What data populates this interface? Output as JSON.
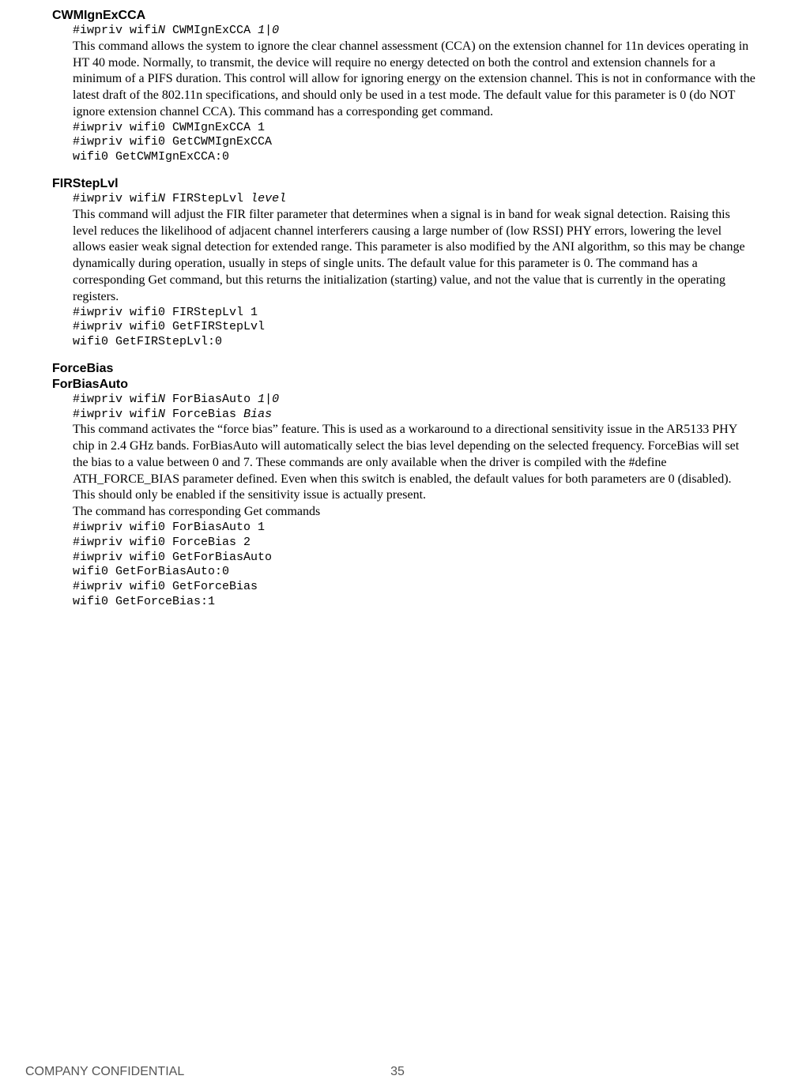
{
  "sections": [
    {
      "title": "CWMIgnExCCA",
      "syntax_prefix": "#iwpriv wifi",
      "syntax_var1": "N",
      "syntax_mid": " CWMIgnExCCA ",
      "syntax_var2": "1|0",
      "desc": "This command allows the system to ignore the clear channel assessment (CCA) on the extension channel for 11n devices operating in HT 40 mode. Normally, to transmit, the device will require no energy detected on both the control and extension channels for a minimum of a PIFS duration. This control will allow for ignoring energy on the extension channel. This is not in conformance with the latest draft of the 802.11n specifications, and should only be used in a test mode. The default value for this parameter is 0 (do NOT ignore extension channel CCA). This command has a corresponding get command.",
      "example": "#iwpriv wifi0 CWMIgnExCCA 1\n#iwpriv wifi0 GetCWMIgnExCCA\nwifi0 GetCWMIgnExCCA:0"
    },
    {
      "title": "FIRStepLvl",
      "syntax_prefix": "#iwpriv wifi",
      "syntax_var1": "N",
      "syntax_mid": " FIRStepLvl ",
      "syntax_var2": "level",
      "desc": "This command will adjust the FIR filter parameter that determines when a signal is in band for weak signal detection. Raising this level reduces the likelihood of adjacent channel interferers causing a large number of (low RSSI) PHY errors, lowering the level allows easier weak signal detection for extended range. This parameter is also modified by the ANI algorithm, so this may be change dynamically during operation, usually in steps of single units. The default value for this parameter is 0. The command has a corresponding Get command, but this returns the initialization (starting) value, and not the value that is currently in the operating registers.",
      "example": "#iwpriv wifi0 FIRStepLvl 1\n#iwpriv wifi0 GetFIRStepLvl\nwifi0 GetFIRStepLvl:0"
    },
    {
      "title": "ForceBias",
      "title2": "ForBiasAuto",
      "syntax_prefix": "#iwpriv wifi",
      "syntax_var1": "N",
      "syntax_mid": " ForBiasAuto ",
      "syntax_var2": "1|0",
      "syntax2_prefix": "#iwpriv wifi",
      "syntax2_var1": "N",
      "syntax2_mid": " ForceBias ",
      "syntax2_var2": "Bias",
      "desc": "This command activates the “force bias” feature. This is used as a workaround to a directional sensitivity issue in the AR5133 PHY chip in 2.4 GHz bands. ForBiasAuto will automatically select the bias level depending on the selected frequency. ForceBias will set the bias to a value between 0 and 7. These commands are only available when the driver is compiled with the #define ATH_FORCE_BIAS parameter defined. Even when this switch is enabled, the default values for both parameters are 0 (disabled). This should only be enabled if the sensitivity issue is actually present.",
      "desc2": "The command has corresponding Get commands",
      "example": "#iwpriv wifi0 ForBiasAuto 1\n#iwpriv wifi0 ForceBias 2\n#iwpriv wifi0 GetForBiasAuto\nwifi0 GetForBiasAuto:0\n#iwpriv wifi0 GetForceBias\nwifi0 GetForceBias:1"
    }
  ],
  "footer": {
    "left": "COMPANY CONFIDENTIAL",
    "center": "35"
  }
}
